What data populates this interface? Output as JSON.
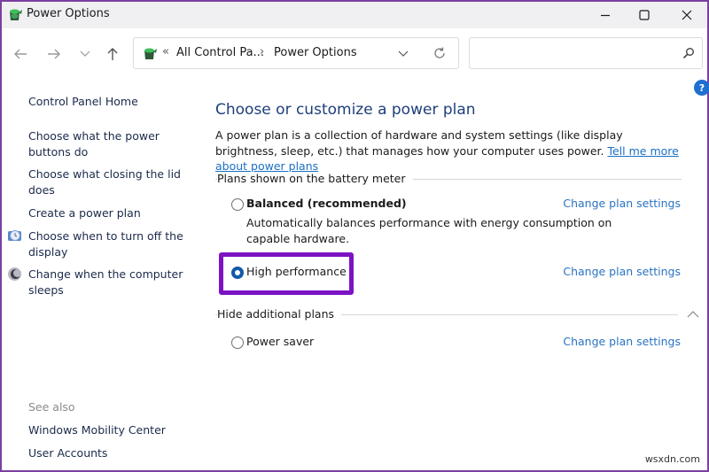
{
  "window": {
    "title": "Power Options",
    "controls": {
      "minimize": "minimize",
      "maximize": "maximize",
      "close": "close"
    }
  },
  "navbar": {
    "back": "back-arrow",
    "forward": "forward-arrow",
    "recent": "chevron-down",
    "up": "up-arrow",
    "address": {
      "overflow": "«",
      "crumbs": [
        "All Control Pa...",
        "Power Options"
      ],
      "separator": "›"
    },
    "search": {
      "placeholder": "",
      "value": ""
    }
  },
  "sidebar": {
    "home": "Control Panel Home",
    "links": [
      {
        "label": "Choose what the power buttons do",
        "icon": null
      },
      {
        "label": "Choose what closing the lid does",
        "icon": null
      },
      {
        "label": "Create a power plan",
        "icon": null
      },
      {
        "label": "Choose when to turn off the display",
        "icon": "display-icon"
      },
      {
        "label": "Change when the computer sleeps",
        "icon": "sleep-icon"
      }
    ],
    "see_also": {
      "heading": "See also",
      "links": [
        "Windows Mobility Center",
        "User Accounts"
      ]
    }
  },
  "main": {
    "title": "Choose or customize a power plan",
    "description": "A power plan is a collection of hardware and system settings (like display brightness, sleep, etc.) that manages how your computer uses power.",
    "learn_more": "Tell me more about power plans",
    "battery_section": "Plans shown on the battery meter",
    "additional_section": "Hide additional plans",
    "plans": [
      {
        "name": "Balanced (recommended)",
        "bold": true,
        "selected": false,
        "description": "Automatically balances performance with energy consumption on capable hardware.",
        "action": "Change plan settings"
      },
      {
        "name": "High performance",
        "bold": false,
        "selected": true,
        "description": "",
        "action": "Change plan settings"
      },
      {
        "name": "Power saver",
        "bold": false,
        "selected": false,
        "description": "",
        "action": "Change plan settings"
      }
    ]
  },
  "colors": {
    "accent": "#1259a8",
    "link": "#2a73c2",
    "heading": "#1e3f7a",
    "highlight": "#7c12c4"
  },
  "watermark": "wsxdn.com"
}
